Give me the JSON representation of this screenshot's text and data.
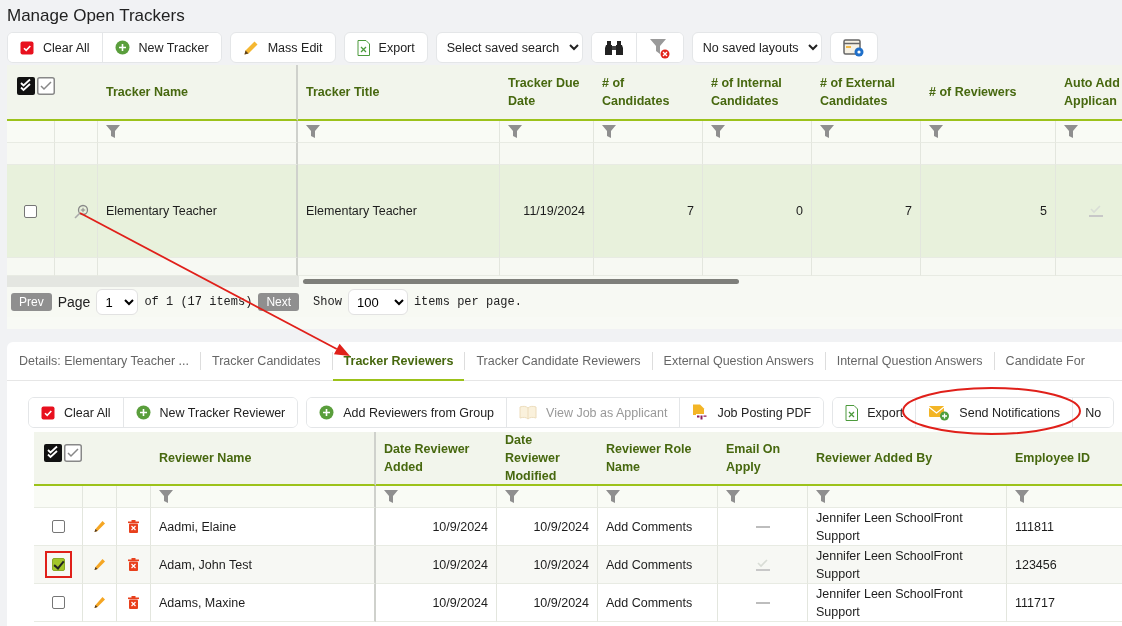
{
  "page_title": "Manage Open Trackers",
  "toolbar": [
    {
      "kind": "group",
      "buttons": [
        {
          "kind": "clear",
          "label": "Clear All",
          "disabled": false
        },
        {
          "kind": "add",
          "label": "New Tracker",
          "disabled": false
        }
      ]
    },
    {
      "kind": "group",
      "buttons": [
        {
          "kind": "edit",
          "label": "Mass Edit",
          "disabled": false
        }
      ]
    },
    {
      "kind": "group",
      "buttons": [
        {
          "kind": "export",
          "label": "Export",
          "disabled": false
        }
      ]
    },
    {
      "kind": "select",
      "value": "Select saved search"
    },
    {
      "kind": "group",
      "buttons": [
        {
          "kind": "binoculars",
          "disabled": false
        },
        {
          "kind": "clear-filter",
          "disabled": false
        }
      ]
    },
    {
      "kind": "select",
      "value": "No saved layouts"
    },
    {
      "kind": "group",
      "buttons": [
        {
          "kind": "layout",
          "disabled": false
        }
      ]
    }
  ],
  "trackers_table": {
    "columns": [
      {
        "label": "Tracker Name",
        "kind": "text"
      },
      {
        "label": "Tracker Title",
        "kind": "text"
      },
      {
        "label": "Tracker Due Date",
        "kind": "number"
      },
      {
        "label": "# of Candidates",
        "kind": "number"
      },
      {
        "label": "# of Internal Candidates",
        "kind": "number"
      },
      {
        "label": "# of External Candidates",
        "kind": "number"
      },
      {
        "label": "# of Reviewers",
        "kind": "number"
      },
      {
        "label": "Auto Add Applican",
        "kind": "flag"
      }
    ],
    "rows": [
      {
        "checked": false,
        "selected": true,
        "cells": [
          "Elementary Teacher",
          "Elementary Teacher",
          "11/19/2024",
          "7",
          "0",
          "7",
          "5",
          true
        ]
      }
    ]
  },
  "pager": {
    "prev": {
      "label": "Prev",
      "disabled": true
    },
    "page_label": "Page",
    "page": "1",
    "of_text": "of 1 (17 items)",
    "next": {
      "label": "Next",
      "disabled": true
    },
    "show_label": "Show",
    "page_size": "100",
    "per_page_text": "items per page."
  },
  "detail_tabs": [
    {
      "label": "Details: Elementary Teacher ...",
      "selected": false
    },
    {
      "label": "Tracker Candidates",
      "selected": false
    },
    {
      "label": "Tracker Reviewers",
      "selected": true
    },
    {
      "label": "Tracker Candidate Reviewers",
      "selected": false
    },
    {
      "label": "External Question Answers",
      "selected": false
    },
    {
      "label": "Internal Question Answers",
      "selected": false
    },
    {
      "label": "Candidate For",
      "selected": false
    }
  ],
  "reviewer_toolbar": [
    {
      "kind": "group",
      "buttons": [
        {
          "kind": "clear",
          "label": "Clear All",
          "disabled": false
        },
        {
          "kind": "add",
          "label": "New Tracker Reviewer",
          "disabled": false
        }
      ]
    },
    {
      "kind": "group",
      "buttons": [
        {
          "kind": "add",
          "label": "Add Reviewers from Group",
          "disabled": false
        },
        {
          "kind": "book",
          "label": "View Job as Applicant",
          "disabled": true
        },
        {
          "kind": "pdf",
          "label": "Job Posting PDF",
          "disabled": false
        }
      ]
    },
    {
      "kind": "group",
      "buttons": [
        {
          "kind": "export",
          "label": "Export",
          "disabled": false
        },
        {
          "kind": "mail",
          "label": "Send Notifications",
          "disabled": false
        },
        {
          "kind": "plain",
          "label": "No",
          "disabled": false
        }
      ]
    }
  ],
  "reviewers_table": {
    "columns": [
      {
        "label": "Reviewer Name",
        "kind": "text"
      },
      {
        "label": "Date Reviewer Added",
        "kind": "number"
      },
      {
        "label": "Date Reviewer Modified",
        "kind": "number"
      },
      {
        "label": "Reviewer Role Name",
        "kind": "text"
      },
      {
        "label": "Email On Apply",
        "kind": "flag"
      },
      {
        "label": "Reviewer Added By",
        "kind": "text"
      },
      {
        "label": "Employee ID",
        "kind": "text"
      }
    ],
    "rows": [
      {
        "checked": false,
        "highlighted": false,
        "cells": [
          "Aadmi, Elaine",
          "10/9/2024",
          "10/9/2024",
          "Add Comments",
          false,
          "Jennifer Leen SchoolFront Support",
          "111811"
        ]
      },
      {
        "checked": true,
        "highlighted": true,
        "cells": [
          "Adam, John Test",
          "10/9/2024",
          "10/9/2024",
          "Add Comments",
          true,
          "Jennifer Leen SchoolFront Support",
          "123456"
        ]
      },
      {
        "checked": false,
        "highlighted": false,
        "cells": [
          "Adams, Maxine",
          "10/9/2024",
          "10/9/2024",
          "Add Comments",
          false,
          "Jennifer Leen SchoolFront Support",
          "111717"
        ]
      }
    ]
  },
  "annotations": [
    {
      "kind": "arrow"
    },
    {
      "kind": "ellipse"
    }
  ]
}
